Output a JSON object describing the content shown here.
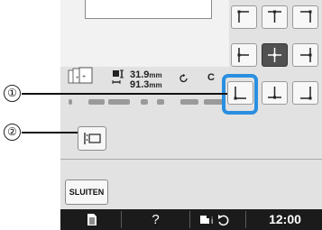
{
  "status": {
    "width_value": "31.9",
    "height_value": "91.3",
    "unit": "mm",
    "partial_char": "C"
  },
  "callouts": {
    "one": "①",
    "two": "②"
  },
  "position_grid": [
    {
      "name": "top-left",
      "selected": false
    },
    {
      "name": "top-center",
      "selected": false
    },
    {
      "name": "top-right",
      "selected": false
    },
    {
      "name": "center-left",
      "selected": false
    },
    {
      "name": "center",
      "selected": true
    },
    {
      "name": "center-right",
      "selected": false
    },
    {
      "name": "bottom-left",
      "selected": false,
      "highlighted": true
    },
    {
      "name": "bottom-center",
      "selected": false
    },
    {
      "name": "bottom-right",
      "selected": false
    }
  ],
  "buttons": {
    "close_label": "SLUITEN"
  },
  "bottom_bar": {
    "help": "?",
    "clock": "12:00"
  },
  "colors": {
    "panel": "#e2e2e2",
    "highlight": "#2a8fe0",
    "selected": "#515151",
    "bottom_bar": "#1b1b1b"
  }
}
